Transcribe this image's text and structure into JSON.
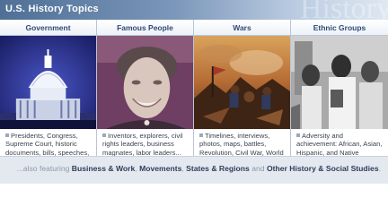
{
  "banner": {
    "title": "U.S. History Topics",
    "watermark": "History"
  },
  "columns": [
    {
      "heading": "Government",
      "image": "capitol-dome-image",
      "description": "Presidents, Congress, Supreme Court, historic documents, bills, speeches, decisions..."
    },
    {
      "heading": "Famous People",
      "image": "smiling-woman-portrait",
      "description": "Inventors, explorers, civil rights leaders, business magnates, labor leaders..."
    },
    {
      "heading": "Wars",
      "image": "battle-painting",
      "description": "Timelines, interviews, photos, maps, battles, Revolution, Civil War, World Wars..."
    },
    {
      "heading": "Ethnic Groups",
      "image": "civil-rights-photo",
      "description": "Adversity and achievement: African, Asian, Hispanic, and Native Americans..."
    }
  ],
  "footer": {
    "prefix": "...also featuring",
    "link1": "Business & Work",
    "sep1": ",",
    "link2": "Movements",
    "sep2": ",",
    "link3": "States & Regions",
    "conj": "and",
    "link4": "Other History & Social Studies",
    "suffix": "."
  },
  "colors": {
    "banner": "#6a88ad",
    "heading": "#2e4a78",
    "footer_bg": "#e4e9f0"
  }
}
